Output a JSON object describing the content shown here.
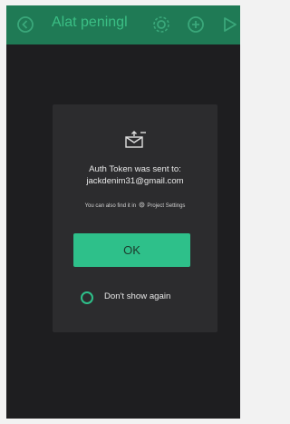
{
  "topbar": {
    "title": "Alat peningl",
    "left_icon": "back-circle-icon",
    "icons": [
      "settings-icon",
      "add-circle-icon",
      "play-icon"
    ]
  },
  "dialog": {
    "icon": "mail-sent-icon",
    "title_line1": "Auth Token was sent to:",
    "title_line2": "jackdenim31@gmail.com",
    "hint_before": "You can also find it in",
    "hint_after": "Project Settings",
    "ok_label": "OK",
    "checkbox_label": "Don't show again"
  },
  "colors": {
    "brand_green": "#2ec08a",
    "topbar_bg": "#1f7a55",
    "dialog_bg": "#2c2c2e",
    "screen_bg": "#1e1e20"
  }
}
